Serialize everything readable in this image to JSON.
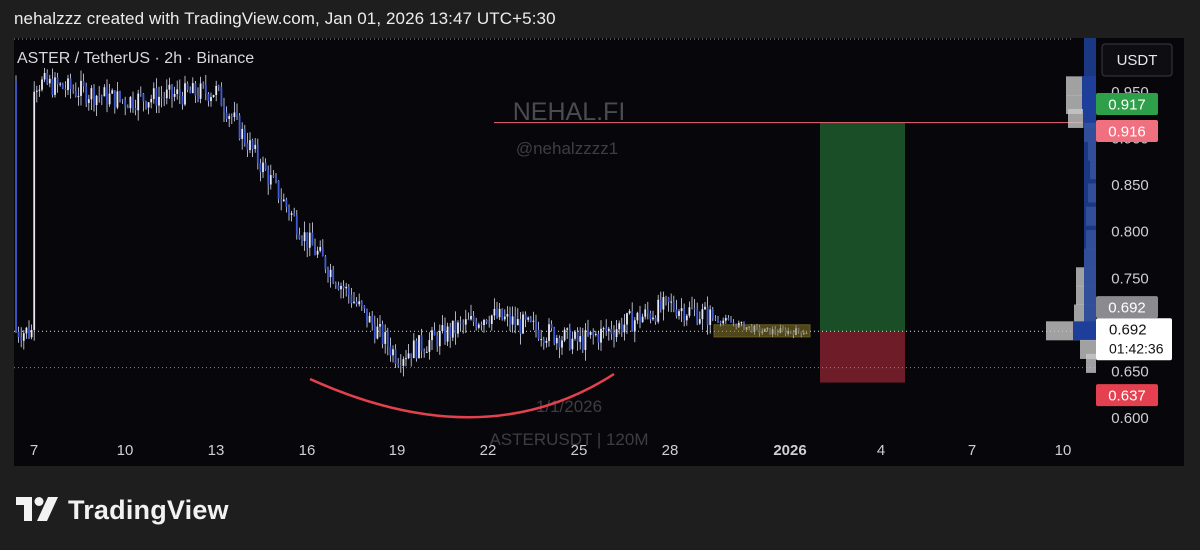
{
  "header": {
    "snapshot_caption": "nehalzzz created with TradingView.com, Jan 01, 2026 13:47 UTC+5:30"
  },
  "footer": {
    "brand": "TradingView"
  },
  "colors": {
    "background": "#07070b",
    "candle": "#3f5bd6",
    "current_line": "#c8c8c8",
    "target_line": "#f06a76",
    "profit_zone": "#1d5a2c",
    "loss_zone": "#7a1f2a",
    "curve": "#e3414d",
    "box": "#8a7a2a",
    "volume_profile": "#c8c8c8",
    "volume_profile_blue": "#1d3f9a"
  },
  "chart_data": {
    "type": "candlestick",
    "symbol_label": "ASTER / TetherUS · 2h · Binance",
    "watermark_brand": "NEHAL.FI",
    "watermark_handle": "@nehalzzzz1",
    "watermark_date": "1/1/2026",
    "watermark_symbol": "ASTERUSDT | 120M",
    "currency_button": "USDT",
    "x_axis_ticks": [
      "7",
      "10",
      "13",
      "16",
      "19",
      "22",
      "25",
      "28",
      "2026",
      "4",
      "7",
      "10"
    ],
    "y_axis_ticks": [
      "0.950",
      "0.900",
      "0.850",
      "0.800",
      "0.750",
      "0.650",
      "0.600"
    ],
    "ylim": [
      0.57,
      0.99
    ],
    "price_tags": {
      "take_profit": "0.917",
      "target_line": "0.916",
      "last_close": "0.692",
      "current_price": "0.692",
      "countdown": "01:42:36",
      "stop_loss": "0.637"
    },
    "approx_daily_closes": {
      "dates": [
        "Dec 7",
        "Dec 10",
        "Dec 13",
        "Dec 16",
        "Dec 19",
        "Dec 22",
        "Dec 25",
        "Dec 28",
        "Dec 31",
        "Jan 1"
      ],
      "values": [
        0.96,
        0.94,
        0.95,
        0.79,
        0.665,
        0.71,
        0.68,
        0.72,
        0.692,
        0.692
      ]
    },
    "long_position": {
      "entry": 0.692,
      "target": 0.916,
      "stop": 0.637
    },
    "grid": false
  }
}
